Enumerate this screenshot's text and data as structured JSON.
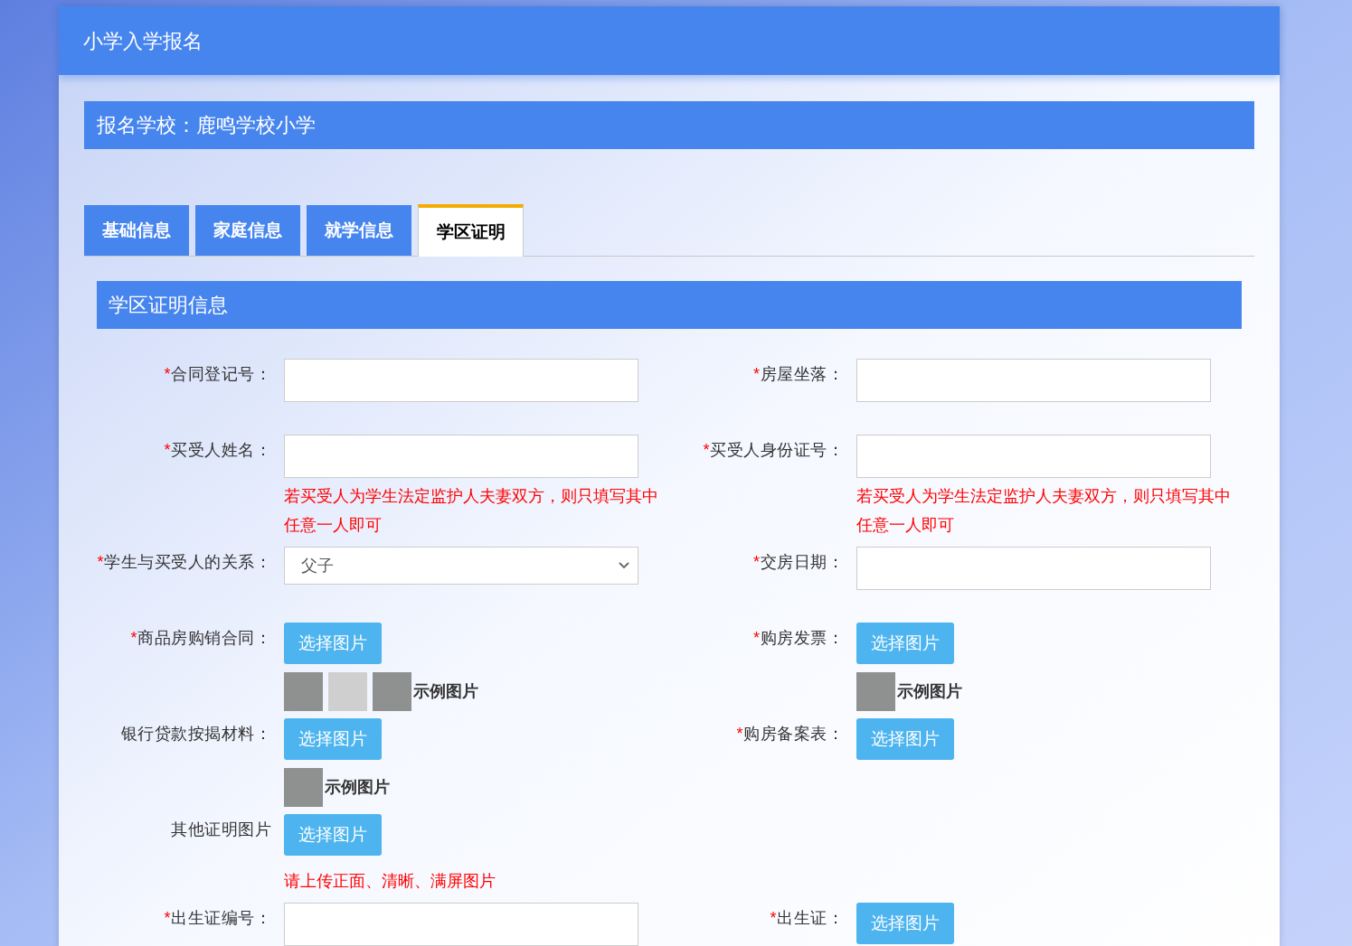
{
  "header": {
    "title": "小学入学报名"
  },
  "school_bar": {
    "text": "报名学校：鹿鸣学校小学"
  },
  "tabs": [
    {
      "label": "基础信息",
      "selected": false
    },
    {
      "label": "家庭信息",
      "selected": false
    },
    {
      "label": "就学信息",
      "selected": false
    },
    {
      "label": "学区证明",
      "selected": true
    }
  ],
  "section": {
    "title": "学区证明信息"
  },
  "rows": [
    {
      "left": {
        "kind": "text",
        "required_mark": "*",
        "label": "合同登记号："
      },
      "right": {
        "kind": "text",
        "required_mark": "*",
        "label": "房屋坐落："
      }
    },
    {
      "left": {
        "kind": "text",
        "required_mark": "*",
        "label": "买受人姓名：",
        "hint": "若买受人为学生法定监护人夫妻双方，则只填写其中任意一人即可"
      },
      "right": {
        "kind": "text",
        "required_mark": "*",
        "label": "买受人身份证号：",
        "hint": "若买受人为学生法定监护人夫妻双方，则只填写其中任意一人即可"
      }
    },
    {
      "left": {
        "kind": "select",
        "required_mark": "*",
        "label": "学生与买受人的关系：",
        "value": "父子"
      },
      "right": {
        "kind": "text",
        "required_mark": "*",
        "label": "交房日期："
      }
    },
    {
      "left": {
        "kind": "upload",
        "required_mark": "*",
        "label": "商品房购销合同：",
        "button": "选择图片",
        "example_photos": [
          {
            "kind": "photo"
          },
          {
            "kind": "photo"
          },
          {
            "kind": "photo"
          }
        ],
        "example_label": "示例图片"
      },
      "right": {
        "kind": "upload",
        "required_mark": "*",
        "label": "购房发票：",
        "button": "选择图片",
        "example_photos": [
          {
            "kind": "photo"
          }
        ],
        "example_label": "示例图片"
      }
    },
    {
      "left": {
        "kind": "upload",
        "label": "银行贷款按揭材料：",
        "button": "选择图片",
        "example_photos": [
          {
            "kind": "photo"
          }
        ],
        "example_label": "示例图片"
      },
      "right": {
        "kind": "upload",
        "required_mark": "*",
        "label": "购房备案表：",
        "button": "选择图片"
      }
    },
    {
      "left": {
        "kind": "upload",
        "label": "其他证明图片",
        "button": "选择图片",
        "hint": "请上传正面、清晰、满屏图片"
      },
      "right": null
    },
    {
      "left": {
        "kind": "text",
        "required_mark": "*",
        "label": "出生证编号："
      },
      "right": {
        "kind": "upload",
        "required_mark": "*",
        "label": "出生证：",
        "button": "选择图片"
      }
    }
  ]
}
